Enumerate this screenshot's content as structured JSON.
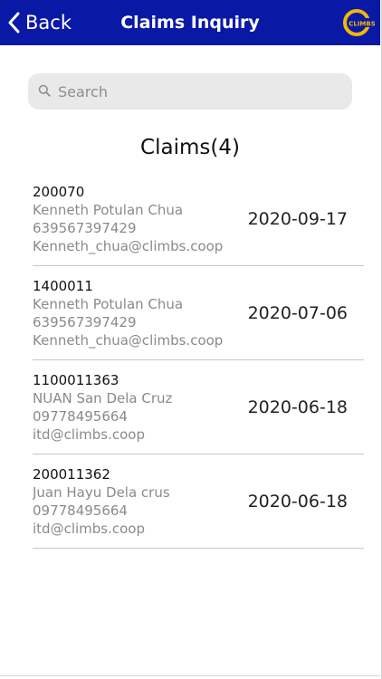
{
  "header": {
    "back_label": "Back",
    "title": "Claims Inquiry",
    "logo_text": "CLIMBS",
    "background_color": "#0a19a5",
    "logo_color": "#f2b705"
  },
  "search": {
    "placeholder": "Search",
    "value": ""
  },
  "list_title": "Claims(4)",
  "claims": [
    {
      "number": "200070",
      "name": "Kenneth Potulan Chua",
      "phone": "639567397429",
      "email": "Kenneth_chua@climbs.coop",
      "date": "2020-09-17"
    },
    {
      "number": "1400011",
      "name": "Kenneth Potulan Chua",
      "phone": "639567397429",
      "email": "Kenneth_chua@climbs.coop",
      "date": "2020-07-06"
    },
    {
      "number": "1100011363",
      "name": "NUAN San Dela Cruz",
      "phone": "09778495664",
      "email": "itd@climbs.coop",
      "date": "2020-06-18"
    },
    {
      "number": "200011362",
      "name": "Juan Hayu Dela crus",
      "phone": "09778495664",
      "email": "itd@climbs.coop",
      "date": "2020-06-18"
    }
  ]
}
